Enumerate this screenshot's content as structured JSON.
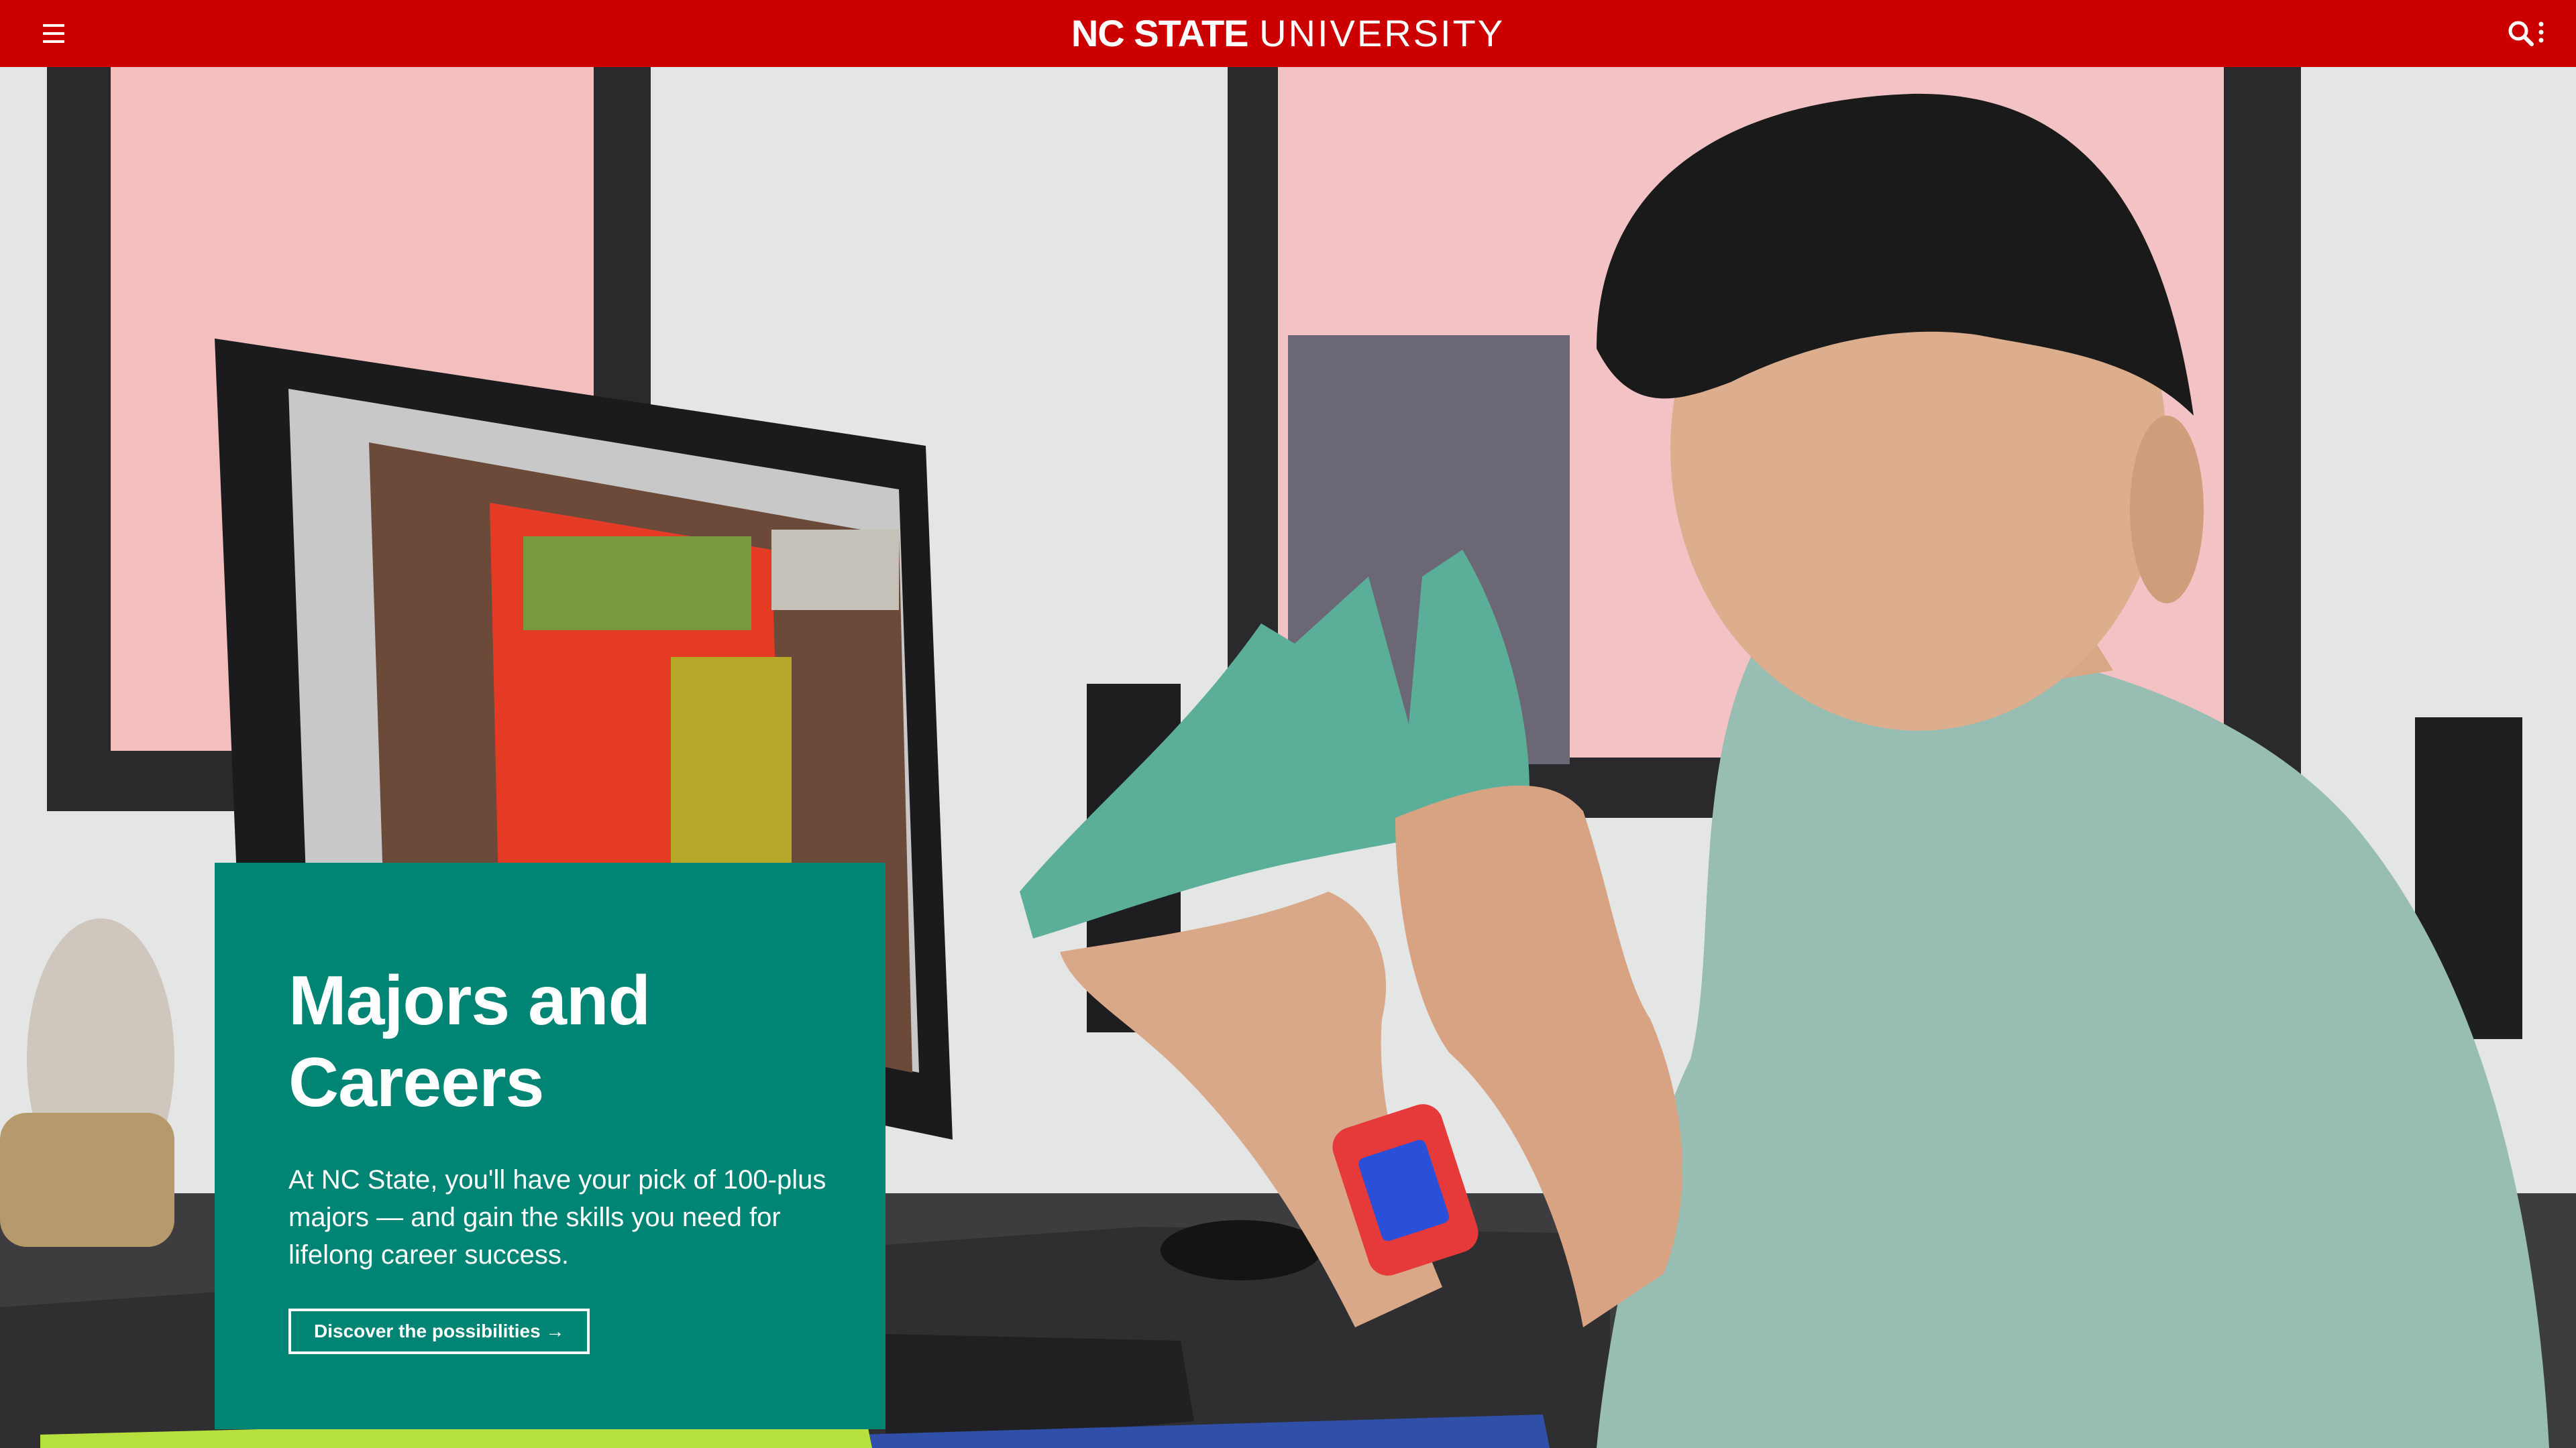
{
  "header": {
    "brand_bold": "NC STATE",
    "brand_light": "UNIVERSITY",
    "menu_icon": "hamburger-icon",
    "search_icon": "search-icon",
    "more_icon": "vertical-dots-icon",
    "bar_color": "#cc0000"
  },
  "hero": {
    "title": "Majors and Careers",
    "description": "At NC State, you'll have your pick of 100-plus majors — and gain the skills you need for lifelong career success.",
    "cta_label": "Discover the possibilities →",
    "card_color": "#008473",
    "photo_subject": "student examining green shoe last beside computer monitor"
  }
}
